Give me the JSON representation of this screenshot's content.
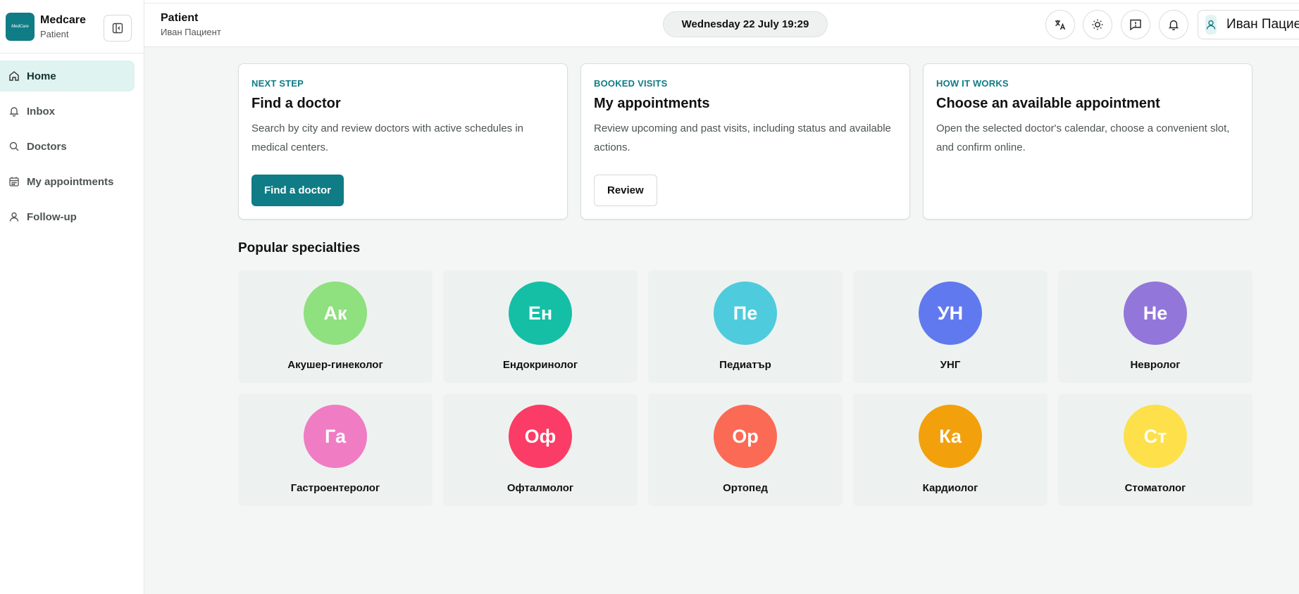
{
  "brand": {
    "title": "Medcare",
    "subtitle": "Patient",
    "logo_text": "MedCare"
  },
  "sidebar": {
    "items": [
      {
        "label": "Home",
        "icon": "home-icon",
        "active": true
      },
      {
        "label": "Inbox",
        "icon": "bell-icon",
        "active": false
      },
      {
        "label": "Doctors",
        "icon": "search-icon",
        "active": false
      },
      {
        "label": "My appointments",
        "icon": "calendar-icon",
        "active": false
      },
      {
        "label": "Follow-up",
        "icon": "user-icon",
        "active": false
      }
    ]
  },
  "header": {
    "title": "Patient",
    "subtitle": "Иван Пациент",
    "datetime": "Wednesday 22 July 19:29",
    "user_name": "Иван Пациент"
  },
  "cards": [
    {
      "eyebrow": "NEXT STEP",
      "title": "Find a doctor",
      "description": "Search by city and review doctors with active schedules in medical centers.",
      "button": "Find a doctor"
    },
    {
      "eyebrow": "BOOKED VISITS",
      "title": "My appointments",
      "description": "Review upcoming and past visits, including status and available actions.",
      "button": "Review"
    },
    {
      "eyebrow": "HOW IT WORKS",
      "title": "Choose an available appointment",
      "description": "Open the selected doctor's calendar, choose a convenient slot, and confirm online."
    }
  ],
  "specialties_title": "Popular specialties",
  "specialties": [
    {
      "abbr": "Ак",
      "name": "Акушер-гинеколог",
      "color": "#8fe07e"
    },
    {
      "abbr": "Ен",
      "name": "Ендокринолог",
      "color": "#14bfa6"
    },
    {
      "abbr": "Пе",
      "name": "Педиатър",
      "color": "#4ecbdc"
    },
    {
      "abbr": "УН",
      "name": "УНГ",
      "color": "#6179ef"
    },
    {
      "abbr": "Не",
      "name": "Невролог",
      "color": "#9376da"
    },
    {
      "abbr": "Га",
      "name": "Гастроентеролог",
      "color": "#f07cc4"
    },
    {
      "abbr": "Оф",
      "name": "Офталмолог",
      "color": "#fb3c66"
    },
    {
      "abbr": "Ор",
      "name": "Ортопед",
      "color": "#fb6a55"
    },
    {
      "abbr": "Ка",
      "name": "Кардиолог",
      "color": "#f2a00c"
    },
    {
      "abbr": "Ст",
      "name": "Стоматолог",
      "color": "#fde04a"
    }
  ]
}
